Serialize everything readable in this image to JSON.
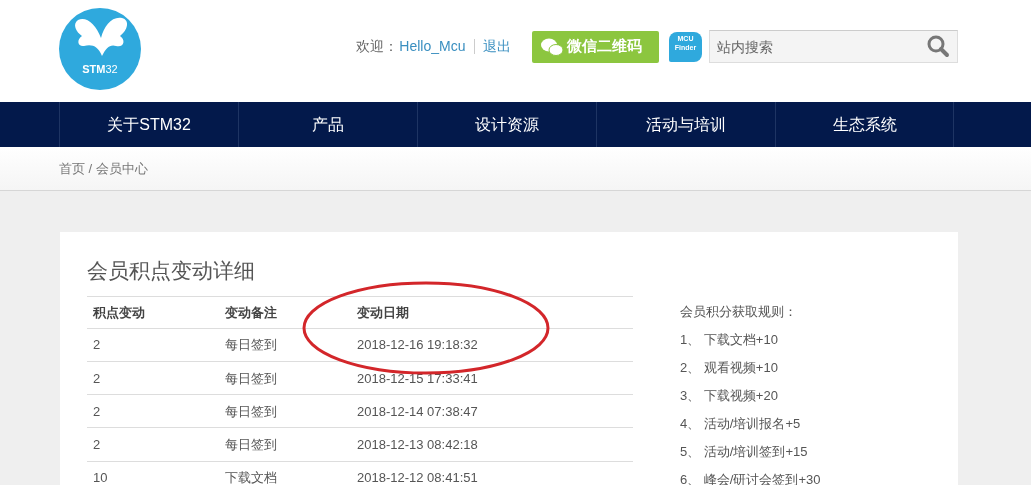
{
  "header": {
    "logo_text": "**STM**32",
    "welcome_label": "欢迎：",
    "username": "Hello_Mcu",
    "logout": "退出",
    "wechat_button": "微信二维码",
    "finder_badge": [
      "MCU",
      "Finder"
    ],
    "search": {
      "placeholder": "站内搜索"
    }
  },
  "nav": [
    "关于STM32",
    "产品",
    "设计资源",
    "活动与培训",
    "生态系统"
  ],
  "breadcrumb": {
    "items": [
      "首页",
      "会员中心"
    ],
    "separator": "/"
  },
  "points_card": {
    "title": "会员积点变动详细",
    "table": {
      "columns": [
        "积点变动",
        "变动备注",
        "变动日期"
      ],
      "rows": [
        [
          "2",
          "每日签到",
          "2018-12-16 19:18:32"
        ],
        [
          "2",
          "每日签到",
          "2018-12-15 17:33:41"
        ],
        [
          "2",
          "每日签到",
          "2018-12-14 07:38:47"
        ],
        [
          "2",
          "每日签到",
          "2018-12-13 08:42:18"
        ],
        [
          "10",
          "下载文档",
          "2018-12-12 08:41:51"
        ]
      ]
    },
    "rules": {
      "title": "会员积分获取规则：",
      "items": [
        "1、 下载文档+10",
        "2、 观看视频+10",
        "3、 下载视频+20",
        "4、 活动/培训报名+5",
        "5、 活动/培训签到+15",
        "6、 峰会/研讨会签到+30"
      ]
    }
  }
}
